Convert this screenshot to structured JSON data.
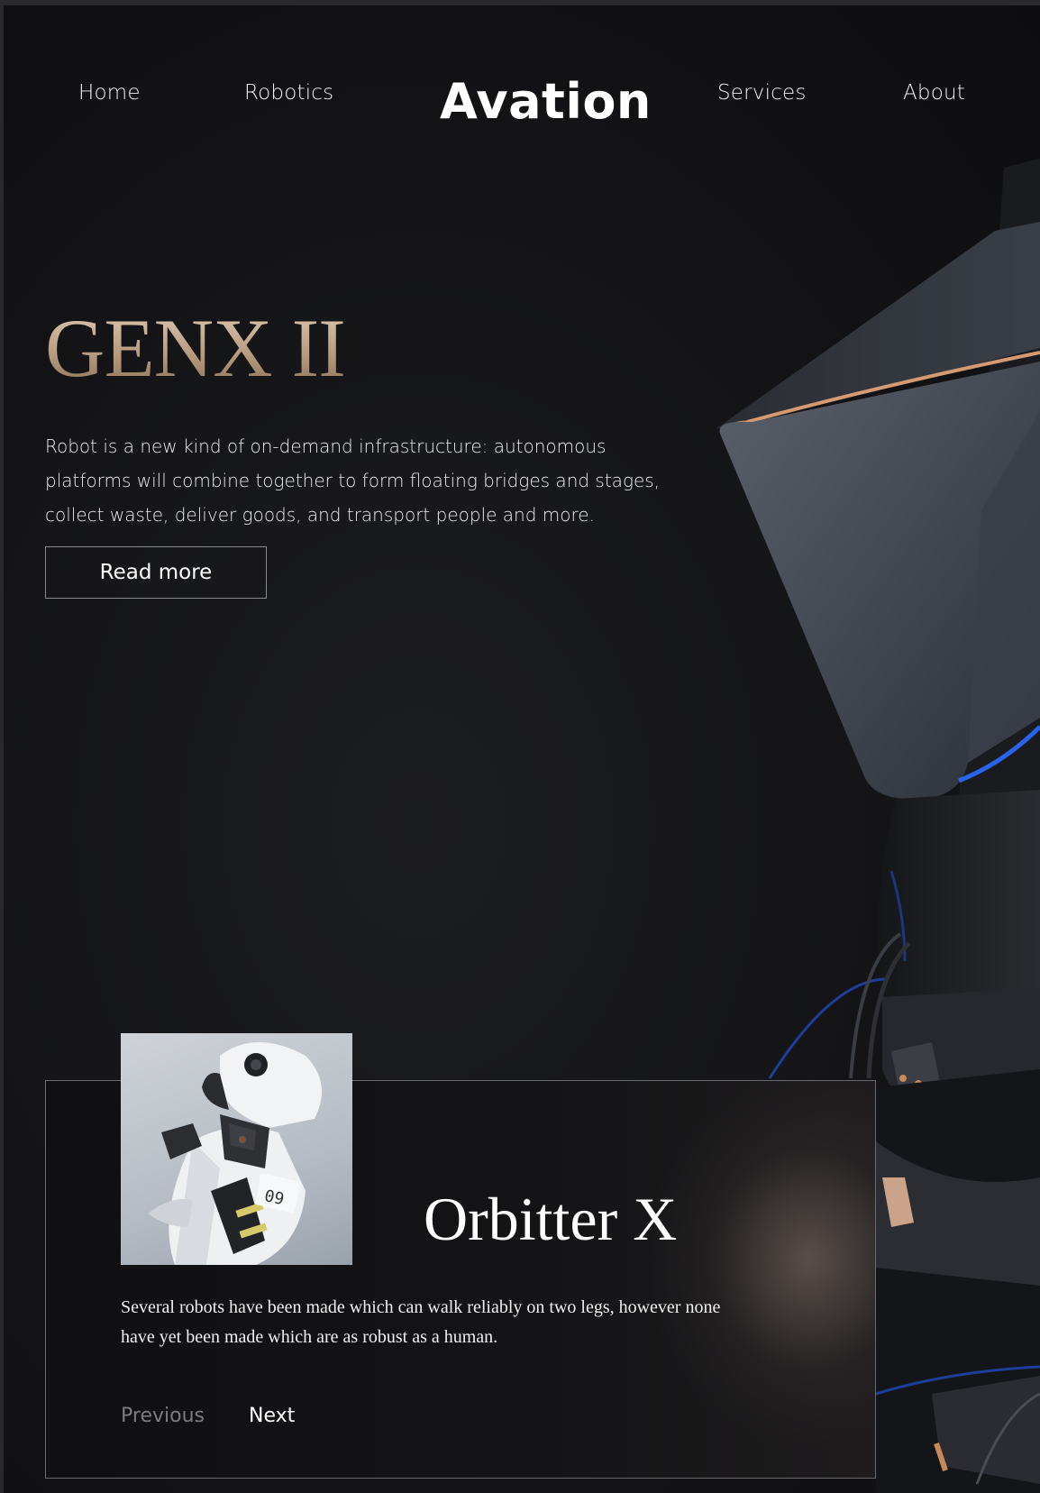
{
  "nav": {
    "home": "Home",
    "robotics": "Robotics",
    "brand": "Avation",
    "services": "Services",
    "about": "About"
  },
  "hero": {
    "title": "GENX II",
    "description": "Robot is a new kind of on-demand infrastructure: autonomous platforms will combine together to form floating bridges and stages, collect waste, deliver goods, and transport people and more.",
    "button_label": "Read more"
  },
  "card": {
    "badge_number": "09",
    "title": "Orbitter X",
    "description": "Several robots have been made which can walk reliably on two legs, however none have yet been made which are as robust as a human.",
    "previous_label": "Previous",
    "next_label": "Next"
  },
  "colors": {
    "background": "#141417",
    "title_gold": "#c9ae90",
    "accent_blue": "#2a6cff",
    "accent_copper": "#c98a5a"
  }
}
